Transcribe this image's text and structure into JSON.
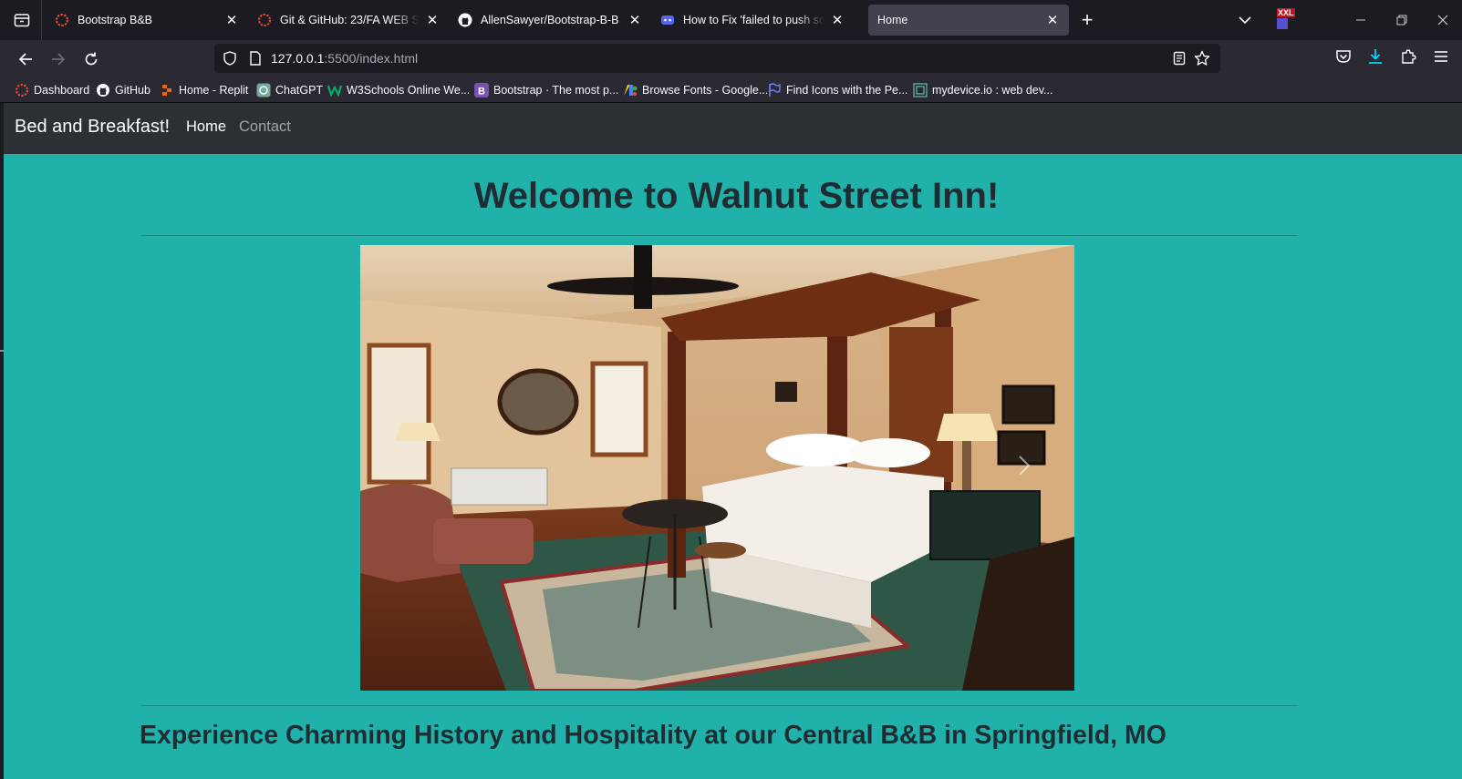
{
  "tabs": [
    {
      "title": "Bootstrap B&B",
      "favicon": "replit-dotted-circle-icon"
    },
    {
      "title": "Git & GitHub: 23/FA WEB SITE DEV",
      "favicon": "replit-dotted-circle-icon"
    },
    {
      "title": "AllenSawyer/Bootstrap-B-B",
      "favicon": "github-icon"
    },
    {
      "title": "How to Fix 'failed to push some refs to'",
      "favicon": "discord-icon"
    },
    {
      "title": "Home",
      "favicon": "none",
      "active": true
    }
  ],
  "extension_badge": "XXL",
  "url": {
    "host": "127.0.0.1",
    "rest": ":5500/index.html"
  },
  "bookmarks": [
    {
      "label": "Dashboard",
      "icon": "replit-dotted-circle-icon"
    },
    {
      "label": "GitHub",
      "icon": "github-icon"
    },
    {
      "label": "Home - Replit",
      "icon": "replit-icon"
    },
    {
      "label": "ChatGPT",
      "icon": "chatgpt-icon"
    },
    {
      "label": "W3Schools Online We...",
      "icon": "w3schools-icon"
    },
    {
      "label": "Bootstrap · The most p...",
      "icon": "bootstrap-icon"
    },
    {
      "label": "Browse Fonts - Google...",
      "icon": "google-fonts-icon"
    },
    {
      "label": "Find Icons with the Pe...",
      "icon": "flag-icon"
    },
    {
      "label": "mydevice.io : web dev...",
      "icon": "mydevice-icon"
    }
  ],
  "site": {
    "brand": "Bed and Breakfast!",
    "nav": {
      "home": "Home",
      "contact": "Contact"
    },
    "heading": "Welcome to Walnut Street Inn!",
    "subheading": "Experience Charming History and Hospitality at our Central B&B in Springfield, MO",
    "bg_color": "#20b2aa",
    "navbar_color": "#2b3035"
  },
  "colors": {
    "browser_bg": "#1c1b22",
    "toolbar_bg": "#2b2a33",
    "active_tab": "#42414d",
    "download_accent": "#00ddff"
  }
}
